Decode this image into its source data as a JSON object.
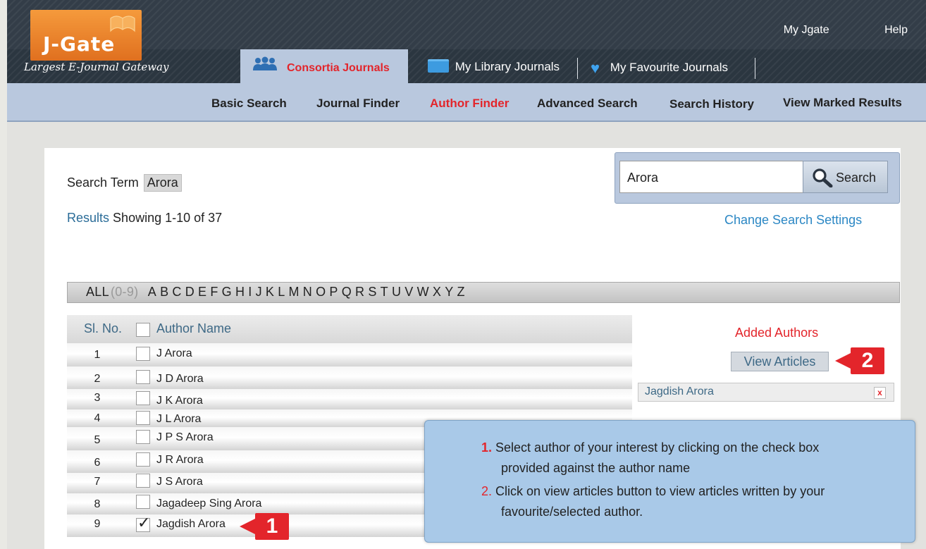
{
  "app": {
    "logo_text": "J-Gate",
    "tagline": "Largest E-Journal Gateway"
  },
  "top_links": [
    "My Jgate",
    "Help"
  ],
  "tabs": {
    "consortia": "Consortia Journals",
    "library": "My Library Journals",
    "favourite": "My Favourite Journals"
  },
  "nav": [
    "Basic Search",
    "Journal Finder",
    "Author Finder",
    "Advanced Search",
    "Search History",
    "View Marked Results"
  ],
  "nav_active": "Author Finder",
  "search": {
    "term_label": "Search Term",
    "term_value": "Arora",
    "input_value": "Arora",
    "button_label": "Search",
    "change_settings": "Change Search Settings"
  },
  "results": {
    "label": "Results",
    "showing": "Showing 1-10 of 37"
  },
  "alphabet": {
    "all": "ALL",
    "nums": "(0-9)",
    "letters": [
      "A",
      "B",
      "C",
      "D",
      "E",
      "F",
      "G",
      "H",
      "I",
      "J",
      "K",
      "L",
      "M",
      "N",
      "O",
      "P",
      "Q",
      "R",
      "S",
      "T",
      "U",
      "V",
      "W",
      "X",
      "Y",
      "Z"
    ]
  },
  "table": {
    "col_sl": "Sl. No.",
    "col_name": "Author Name",
    "rows": [
      {
        "n": "1",
        "name": "J Arora",
        "checked": false
      },
      {
        "n": "2",
        "name": "J D Arora",
        "checked": false
      },
      {
        "n": "3",
        "name": "J K Arora",
        "checked": false
      },
      {
        "n": "4",
        "name": "J L Arora",
        "checked": false
      },
      {
        "n": "5",
        "name": "J P S Arora",
        "checked": false
      },
      {
        "n": "6",
        "name": "J R Arora",
        "checked": false
      },
      {
        "n": "7",
        "name": "J S Arora",
        "checked": false
      },
      {
        "n": "8",
        "name": "Jagadeep Sing Arora",
        "checked": false
      },
      {
        "n": "9",
        "name": "Jagdish Arora",
        "checked": true
      }
    ]
  },
  "added": {
    "title": "Added Authors",
    "view_articles": "View Articles",
    "items": [
      "Jagdish Arora"
    ],
    "remove_label": "x"
  },
  "callouts": [
    "1",
    "2"
  ],
  "instructions": [
    {
      "num": "1.",
      "line1": "Select author of your interest by clicking on the check box",
      "line2": "provided against the author name"
    },
    {
      "num": "2.",
      "line1": "Click on view articles button to view articles written by your",
      "line2": "favourite/selected author."
    }
  ],
  "colors": {
    "accent_red": "#e3252b",
    "nav_blue": "#b9c8de",
    "header_dark": "#333d48",
    "link_blue": "#2b87c4",
    "logo_orange": "#f08a2e"
  },
  "icons": {
    "consortia": "people-icon",
    "library": "folder-icon",
    "favourite": "heart-icon",
    "search": "magnifier-icon"
  }
}
